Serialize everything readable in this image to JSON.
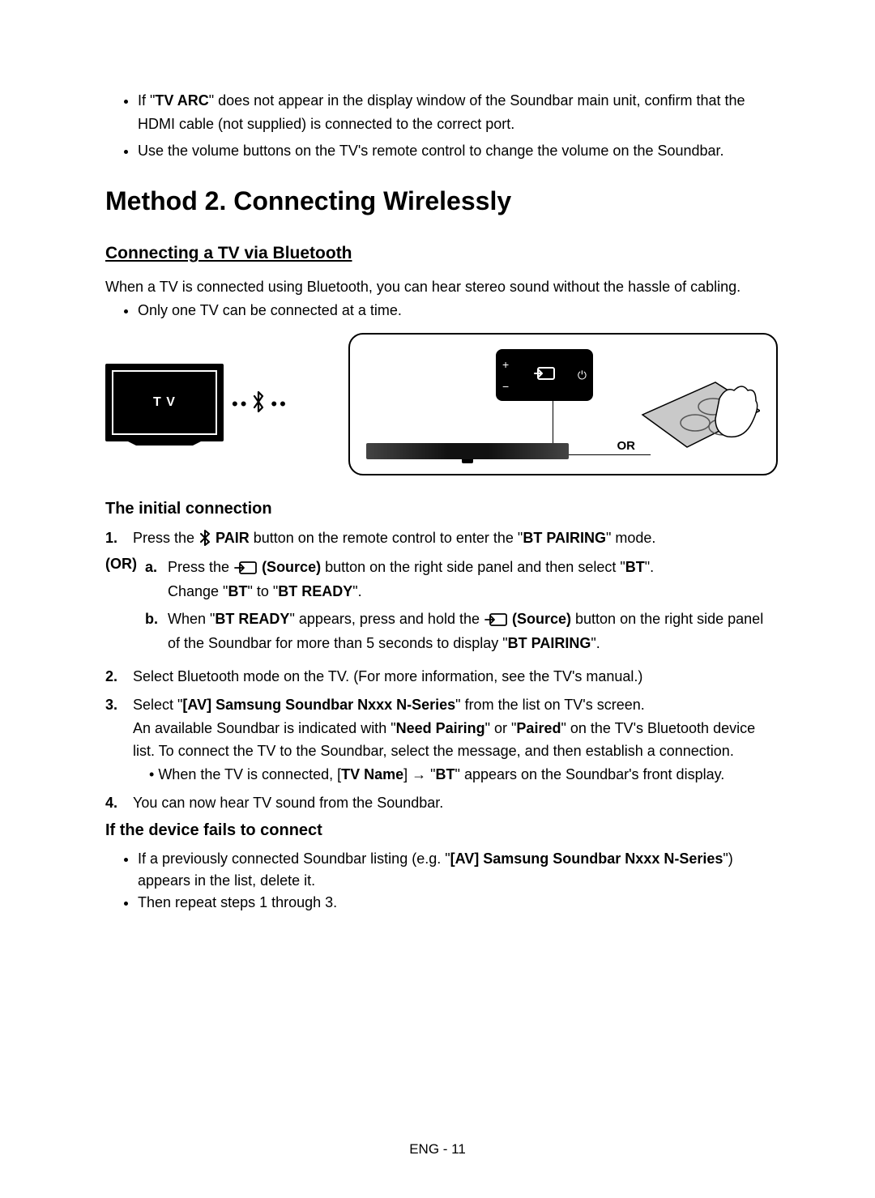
{
  "intro_bullets": [
    {
      "pre": "If \"",
      "b": "TV ARC",
      "post": "\" does not appear in the display window of the Soundbar main unit, confirm that the HDMI cable (not supplied) is connected to the correct port."
    },
    {
      "pre": "",
      "b": "",
      "post": "Use the volume buttons on the TV's remote control to change the volume on the Soundbar."
    }
  ],
  "method_heading": "Method 2. Connecting Wirelessly",
  "subsection_heading": "Connecting a TV via Bluetooth",
  "lead_text": "When a TV is connected using Bluetooth, you can hear stereo sound without the hassle of cabling.",
  "lead_bullet": "Only one TV can be connected at a time.",
  "tv_label": "T V",
  "or_label": "OR",
  "icons": {
    "bluetooth": "✱",
    "source_desc": "source-icon",
    "pair_desc": "bluetooth-icon"
  },
  "initial_heading": "The initial connection",
  "step1": {
    "num": "1.",
    "pre": "Press the ",
    "icon": "bt",
    "bold": " PAIR",
    "mid": " button on the remote control to enter the \"",
    "b2": "BT PAIRING",
    "post": "\" mode."
  },
  "or_marker": "(OR)",
  "sub_a": {
    "alpha": "a.",
    "pre": "Press the ",
    "bold": "(Source)",
    "mid": " button on the right side panel and then select \"",
    "b2": "BT",
    "post": "\".",
    "line2_pre": "Change \"",
    "line2_b1": "BT",
    "line2_mid": "\" to \"",
    "line2_b2": "BT READY",
    "line2_post": "\"."
  },
  "sub_b": {
    "alpha": "b.",
    "pre": "When \"",
    "b1": "BT READY",
    "mid": "\" appears, press and hold the ",
    "bold": "(Source)",
    "mid2": " button on the right side panel of the Soundbar for more than 5 seconds to display \"",
    "b2": "BT PAIRING",
    "post": "\"."
  },
  "step2": {
    "num": "2.",
    "text": "Select Bluetooth mode on the TV. (For more information, see the TV's manual.)"
  },
  "step3": {
    "num": "3.",
    "pre": "Select \"",
    "b1": "[AV] Samsung Soundbar Nxxx N-Series",
    "mid": "\" from the list on TV's screen.",
    "line2_pre": "An available Soundbar is indicated with \"",
    "line2_b1": "Need Pairing",
    "line2_mid": "\" or \"",
    "line2_b2": "Paired",
    "line2_post": "\" on the TV's Bluetooth device list. To connect the TV to the Soundbar, select the message, and then establish a connection.",
    "nested_pre": "When the TV is connected, [",
    "nested_b1": "TV Name",
    "nested_mid": "] → \"",
    "nested_b2": "BT",
    "nested_post": "\" appears on the Soundbar's front display."
  },
  "step4": {
    "num": "4.",
    "text": "You can now hear TV sound from the Soundbar."
  },
  "fail_heading": "If the device fails to connect",
  "fail_bullets": [
    {
      "pre": "If a previously connected Soundbar listing (e.g. \"",
      "b": "[AV] Samsung Soundbar Nxxx N-Series",
      "post": "\") appears in the list, delete it."
    },
    {
      "pre": "",
      "b": "",
      "post": "Then repeat steps 1 through 3."
    }
  ],
  "footer": "ENG - 11"
}
